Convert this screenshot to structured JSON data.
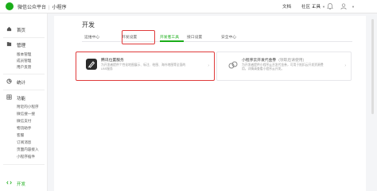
{
  "topbar": {
    "platform": "微信公众平台",
    "product": "小程序",
    "docs": "文档",
    "community": "社区",
    "tools": "工具"
  },
  "sidebar": {
    "home": "首页",
    "manage": {
      "label": "管理",
      "items": [
        "版本管理",
        "成员管理",
        "用户反馈"
      ]
    },
    "stats": "统计",
    "features": {
      "label": "功能",
      "items": [
        "附近的小程序",
        "微信搜一搜",
        "微信支付",
        "物流助手",
        "客服",
        "订阅消息",
        "页面内容接入",
        "小程序插件"
      ]
    },
    "dev": "开发"
  },
  "main": {
    "title": "开发",
    "tabs": [
      "运维中心",
      "开发设置",
      "开发者工具",
      "接口设置",
      "安全中心"
    ],
    "active_tab": 2,
    "cards": [
      {
        "title": "腾讯位置服务",
        "desc": "为开发者提供个性化地图展示、标注、绘图、海外地图等全面的LBS服务"
      },
      {
        "title": "小程序云开发代金券",
        "tag": "(领取后请使用)",
        "desc": "为开发者提供小程序云开发代金券，可用于抵扣云开发资源费用，详情请查看小程序云开发。"
      }
    ]
  },
  "colors": {
    "accent": "#1aad19",
    "highlight": "#e03b3b"
  }
}
